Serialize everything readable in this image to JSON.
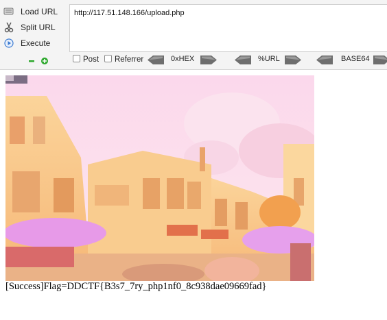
{
  "hackbar": {
    "load_url": "Load URL",
    "split_url": "Split URL",
    "execute": "Execute",
    "url_value": "http://117.51.148.166/upload.php",
    "post_label": "Post",
    "referrer_label": "Referrer",
    "encoders": [
      "0xHEX",
      "%URL",
      "BASE64"
    ]
  },
  "content": {
    "result_text": "[Success]Flag=DDCTF{B3s7_7ry_php1nf0_8c938dae09669fad}"
  },
  "colors": {
    "zoom_minus": "#2ea82e",
    "zoom_plus": "#2ea82e",
    "execute_icon": "#3a7ad1"
  }
}
